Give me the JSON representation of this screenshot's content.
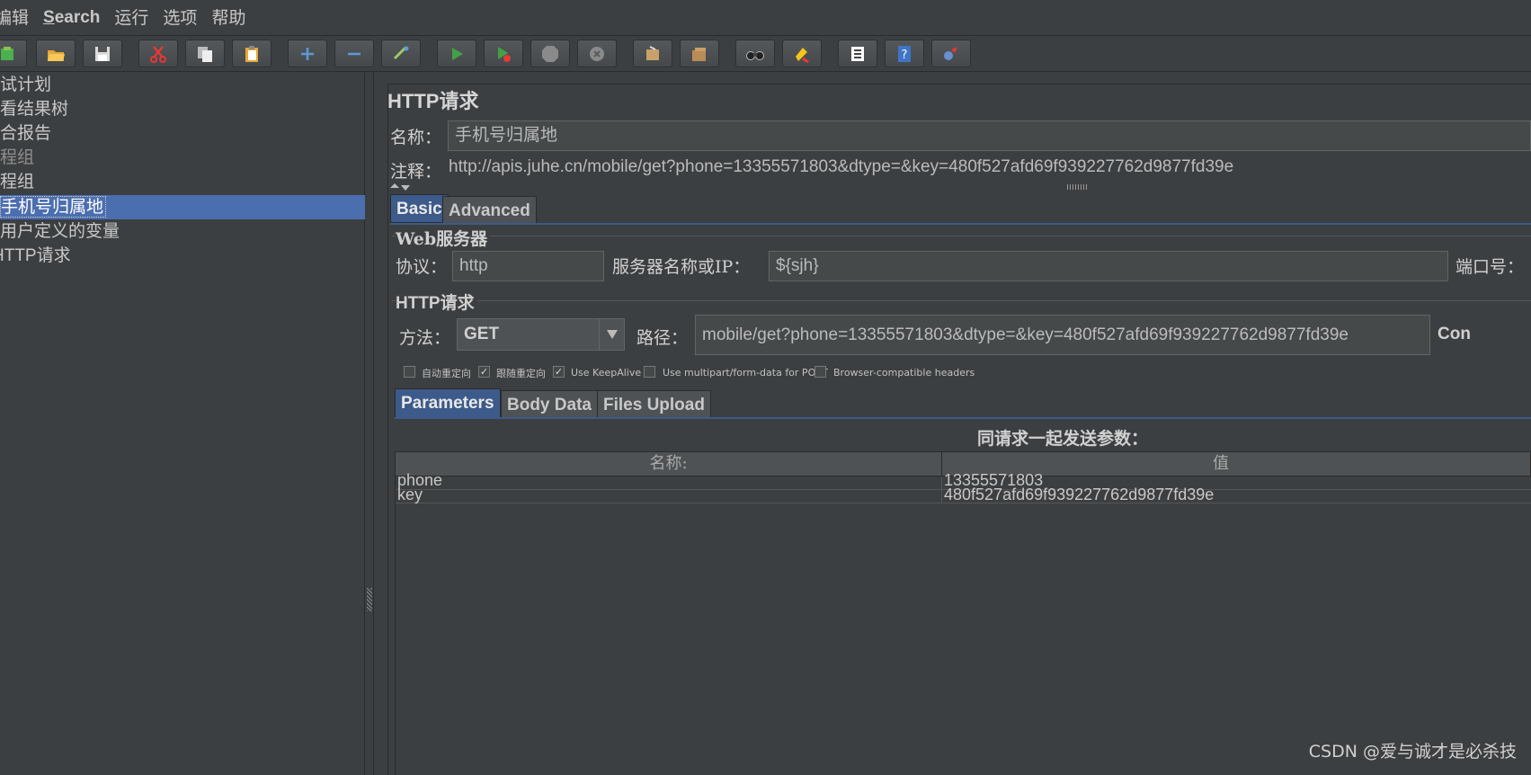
{
  "menu": [
    "编辑",
    "Search",
    "运行",
    "选项",
    "帮助"
  ],
  "toolbar": [
    "template-icon",
    "open-icon",
    "save-icon",
    "cut-icon",
    "copy-icon",
    "paste-icon",
    "expand-icon",
    "collapse-icon",
    "toggle-icon",
    "start-icon",
    "start-no-pause-icon",
    "stop-icon",
    "shutdown-icon",
    "clear-icon",
    "clear-all-icon",
    "search-icon",
    "reset-search-icon",
    "function-helper-icon",
    "help-icon",
    "remote-icon"
  ],
  "tree": {
    "items": [
      {
        "label": "试计划",
        "dim": false
      },
      {
        "label": "看结果树",
        "dim": false
      },
      {
        "label": "合报告",
        "dim": false
      },
      {
        "label": "程组",
        "dim": true
      },
      {
        "label": "程组",
        "dim": false
      },
      {
        "label": "手机号归属地",
        "dim": false,
        "selected": true
      },
      {
        "label": "用户定义的变量",
        "dim": false
      },
      {
        "label": "HTTP请求",
        "dim": false
      }
    ]
  },
  "panel": {
    "title": "HTTP请求",
    "name_label": "名称：",
    "name_value": "手机号归属地",
    "comment_label": "注释：",
    "comment_value": "http://apis.juhe.cn/mobile/get?phone=13355571803&dtype=&key=480f527afd69f939227762d9877fd39e",
    "tabs": [
      "Basic",
      "Advanced"
    ],
    "web_server": {
      "title": "Web服务器",
      "protocol_label": "协议：",
      "protocol_value": "http",
      "server_label": "服务器名称或IP：",
      "server_value": "${sjh}",
      "port_label": "端口号："
    },
    "http_request": {
      "title": "HTTP请求",
      "method_label": "方法：",
      "method_value": "GET",
      "path_label": "路径：",
      "path_value": "mobile/get?phone=13355571803&dtype=&key=480f527afd69f939227762d9877fd39e",
      "encoding_label_partial": "Con"
    },
    "checkboxes": [
      {
        "label": "自动重定向",
        "checked": false
      },
      {
        "label": "跟随重定向",
        "checked": true
      },
      {
        "label": "Use KeepAlive",
        "checked": true
      },
      {
        "label": "Use multipart/form-data for POST",
        "checked": false
      },
      {
        "label": "Browser-compatible headers",
        "checked": false
      }
    ],
    "subtabs": [
      "Parameters",
      "Body Data",
      "Files Upload"
    ],
    "params_caption": "同请求一起发送参数：",
    "table": {
      "columns": [
        "名称:",
        "值"
      ],
      "rows": [
        {
          "name": "phone",
          "value": "13355571803"
        },
        {
          "name": "key",
          "value": "480f527afd69f939227762d9877fd39e"
        }
      ]
    }
  },
  "watermark": "CSDN @爱与诚才是必杀技",
  "colors": {
    "background": "#3c3f41",
    "selection": "#4b6eaf",
    "active_tab": "#3c5a8a",
    "field": "#45494a"
  }
}
